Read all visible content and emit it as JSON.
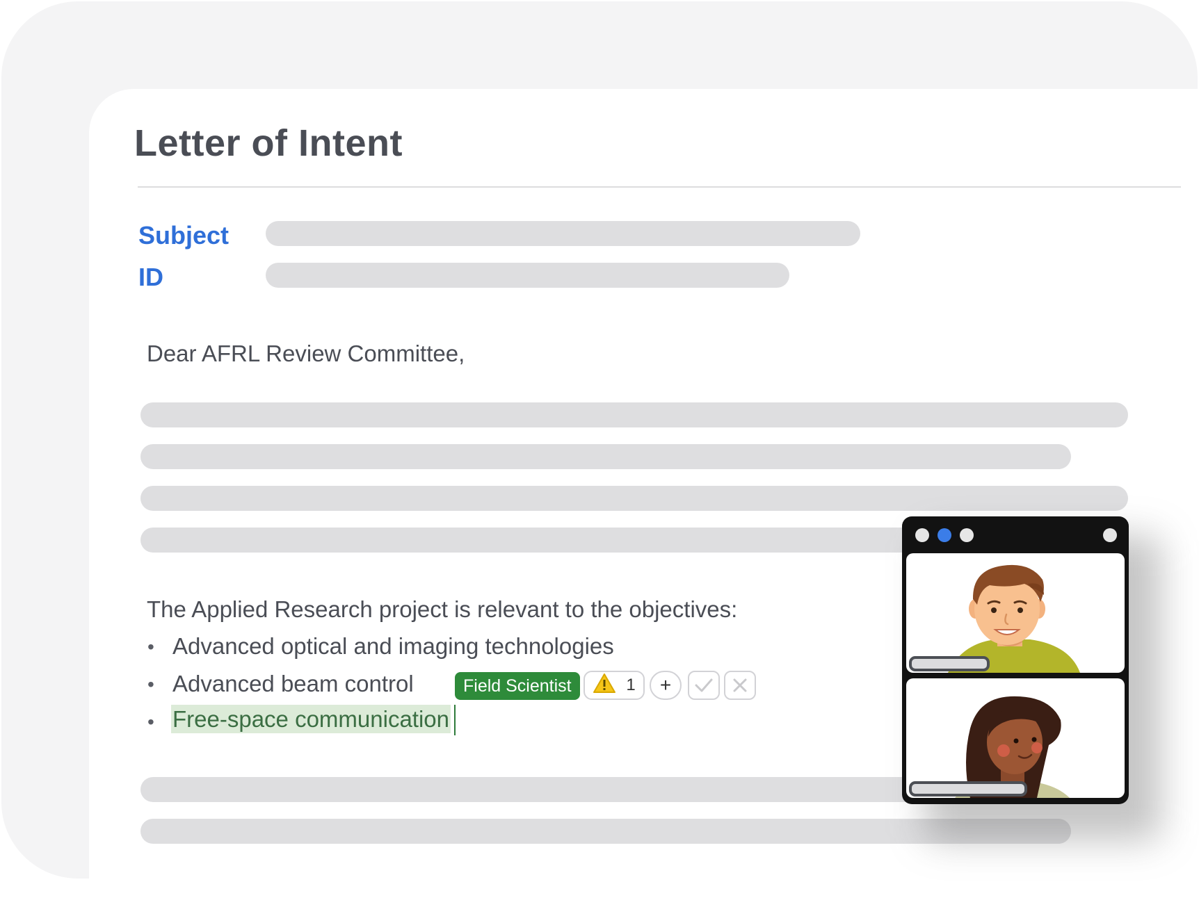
{
  "document": {
    "title": "Letter of Intent",
    "fields": [
      {
        "label": "Subject"
      },
      {
        "label": "ID"
      }
    ],
    "greeting": "Dear AFRL Review Committee,",
    "intro": "The Applied Research project is relevant to the objectives:",
    "bullets": [
      "Advanced optical and imaging technologies",
      "Advanced beam control",
      "Free-space communication"
    ],
    "bullet_marker": "•"
  },
  "suggestion": {
    "author_tag": "Field Scientist",
    "warning_count": "1",
    "add_symbol": "+",
    "accept_icon": "check-icon",
    "reject_icon": "x-icon"
  },
  "video_call": {
    "participants": [
      {
        "avatar": "man-avatar"
      },
      {
        "avatar": "woman-avatar"
      }
    ]
  },
  "colors": {
    "accent_blue": "#2f6fd8",
    "tag_green": "#2e8b3a",
    "highlight": "#dcebd8",
    "placeholder_bar": "#dedee0"
  }
}
